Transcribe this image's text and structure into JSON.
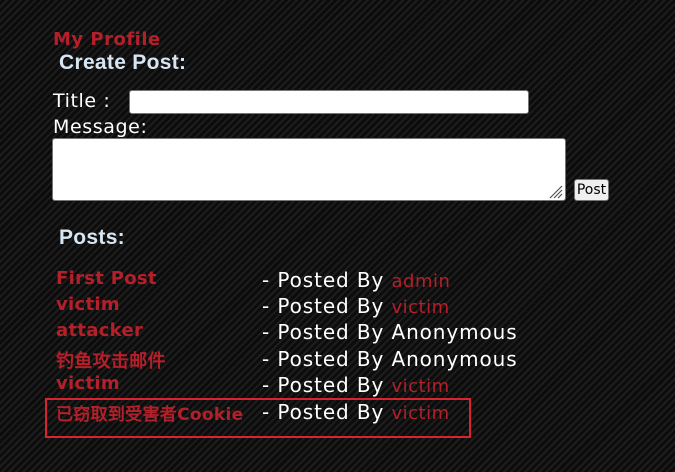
{
  "header": {
    "my_profile_label": "My Profile"
  },
  "create_post": {
    "heading": "Create Post:",
    "title_label": "Title :",
    "title_value": "",
    "message_label": "Message:",
    "message_value": "",
    "submit_label": "Post"
  },
  "posts_section": {
    "heading": "Posts:",
    "posted_by_text": "- Posted By",
    "items": [
      {
        "title": "First Post",
        "author": "admin",
        "author_is_link": true
      },
      {
        "title": "victim",
        "author": "victim",
        "author_is_link": true
      },
      {
        "title": "attacker",
        "author": "Anonymous",
        "author_is_link": false
      },
      {
        "title": "钓鱼攻击邮件",
        "author": "Anonymous",
        "author_is_link": false
      },
      {
        "title": "victim",
        "author": "victim",
        "author_is_link": true
      },
      {
        "title": "已窃取到受害者Cookie",
        "author": "victim",
        "author_is_link": true,
        "highlighted": true
      }
    ]
  },
  "colors": {
    "link": "#b3202a",
    "heading": "#d7e6f2",
    "highlight_border": "#d9232e",
    "text": "#ffffff"
  }
}
